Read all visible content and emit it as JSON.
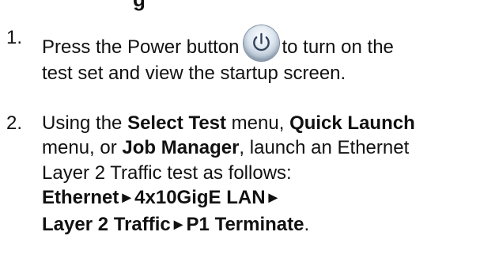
{
  "heading_fragment": "g",
  "steps": [
    {
      "number": "1.",
      "line1_before_icon": "Press the Power button",
      "icon": "power-icon",
      "line1_after_icon": "to turn on the",
      "line2": "test set and view the startup screen."
    },
    {
      "number": "2.",
      "line1_prefix": "Using the ",
      "select_test": "Select Test",
      "line1_middle": " menu, ",
      "quick_launch": "Quick Launch",
      "line2_start": "menu, or ",
      "job_manager": "Job Manager",
      "line2_end": ", launch an Ethernet",
      "line3": "Layer 2 Traffic test as follows:",
      "path": {
        "part1": "Ethernet",
        "part2": "4x10GigE LAN",
        "part3": "Layer 2 Traffic",
        "part4": "P1 Terminate",
        "separator": "►",
        "end_punct": "."
      }
    }
  ]
}
